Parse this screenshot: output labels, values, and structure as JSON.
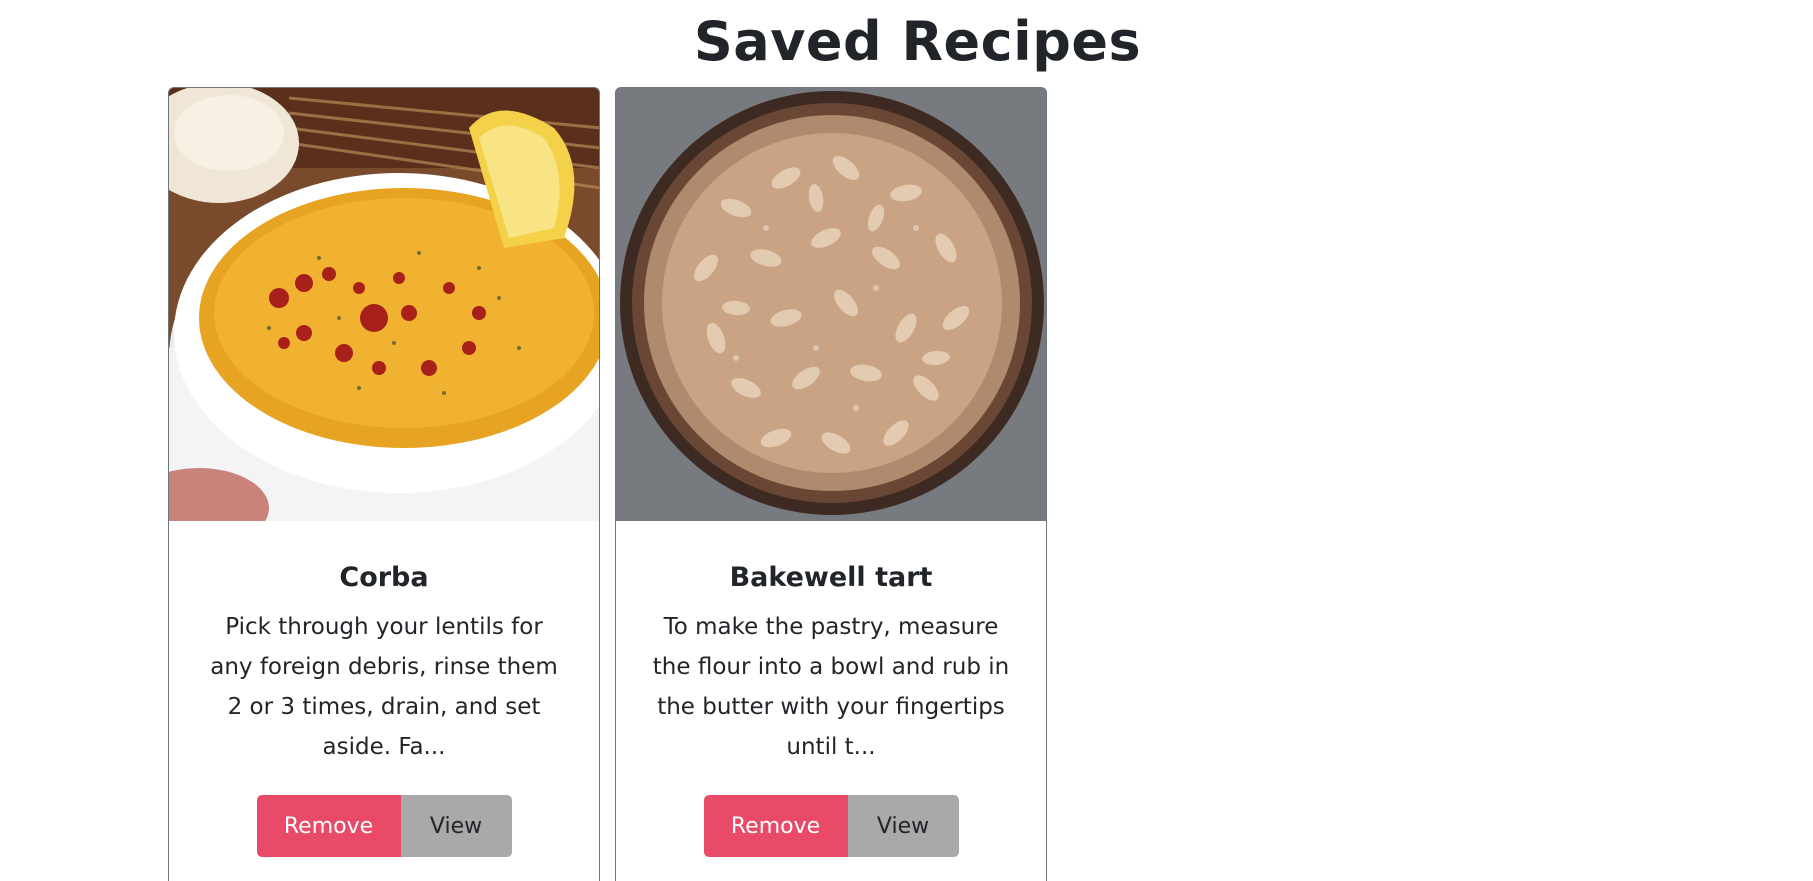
{
  "page": {
    "title": "Saved Recipes"
  },
  "recipes": [
    {
      "name": "Corba",
      "description": "Pick through your lentils for any foreign debris, rinse them 2 or 3 times, drain, and set aside. Fa...",
      "remove_label": "Remove",
      "view_label": "View"
    },
    {
      "name": "Bakewell tart",
      "description": "To make the pastry, measure the flour into a bowl and rub in the butter with your fingertips until t...",
      "remove_label": "Remove",
      "view_label": "View"
    }
  ],
  "colors": {
    "remove_button": "#e84a68",
    "view_button": "#a9a9a9",
    "card_border": "#6c757d"
  }
}
